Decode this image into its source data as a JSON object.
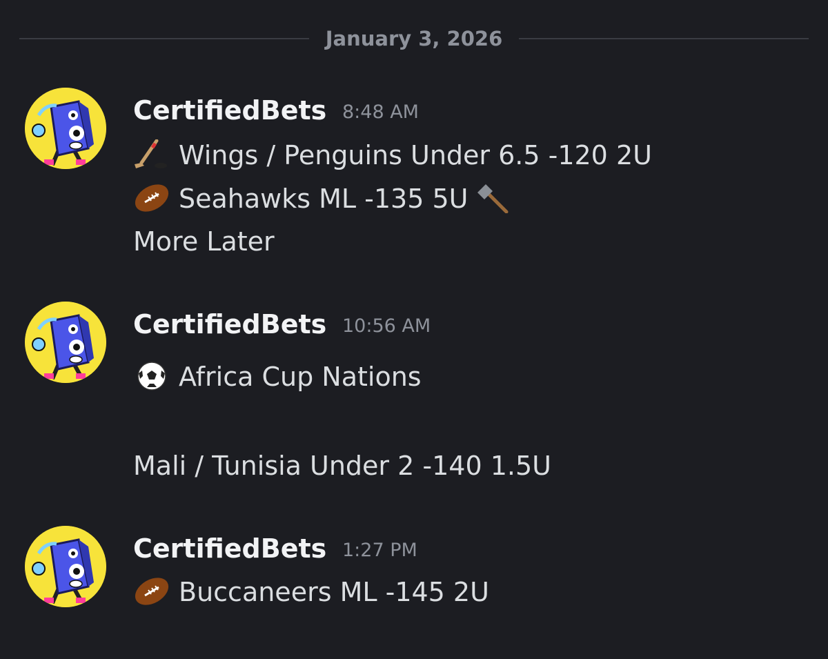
{
  "date_divider": "January 3, 2026",
  "messages": [
    {
      "username": "CertifiedBets",
      "time": "8:48 AM",
      "lines": [
        {
          "icon": "hockey-stick-icon",
          "text": "Wings / Penguins Under 6.5 -120 2U"
        },
        {
          "icon": "american-football-icon",
          "text": "Seahawks ML -135 5U",
          "trailing_icon": "hammer-icon"
        },
        {
          "text": "More Later"
        }
      ]
    },
    {
      "username": "CertifiedBets",
      "time": "10:56 AM",
      "lines": [
        {
          "icon": "soccer-ball-icon",
          "text": "Africa Cup Nations"
        },
        {
          "text": "Mali / Tunisia Under 2 -140 1.5U"
        }
      ]
    },
    {
      "username": "CertifiedBets",
      "time": "1:27 PM",
      "lines": [
        {
          "icon": "american-football-icon",
          "text": "Buccaneers ML -145 2U"
        }
      ]
    }
  ],
  "colors": {
    "background": "#1c1d22",
    "username": "#f2f3f5",
    "text": "#dbdee1",
    "muted": "#8e929b",
    "avatar_bg": "#f7e33a"
  }
}
